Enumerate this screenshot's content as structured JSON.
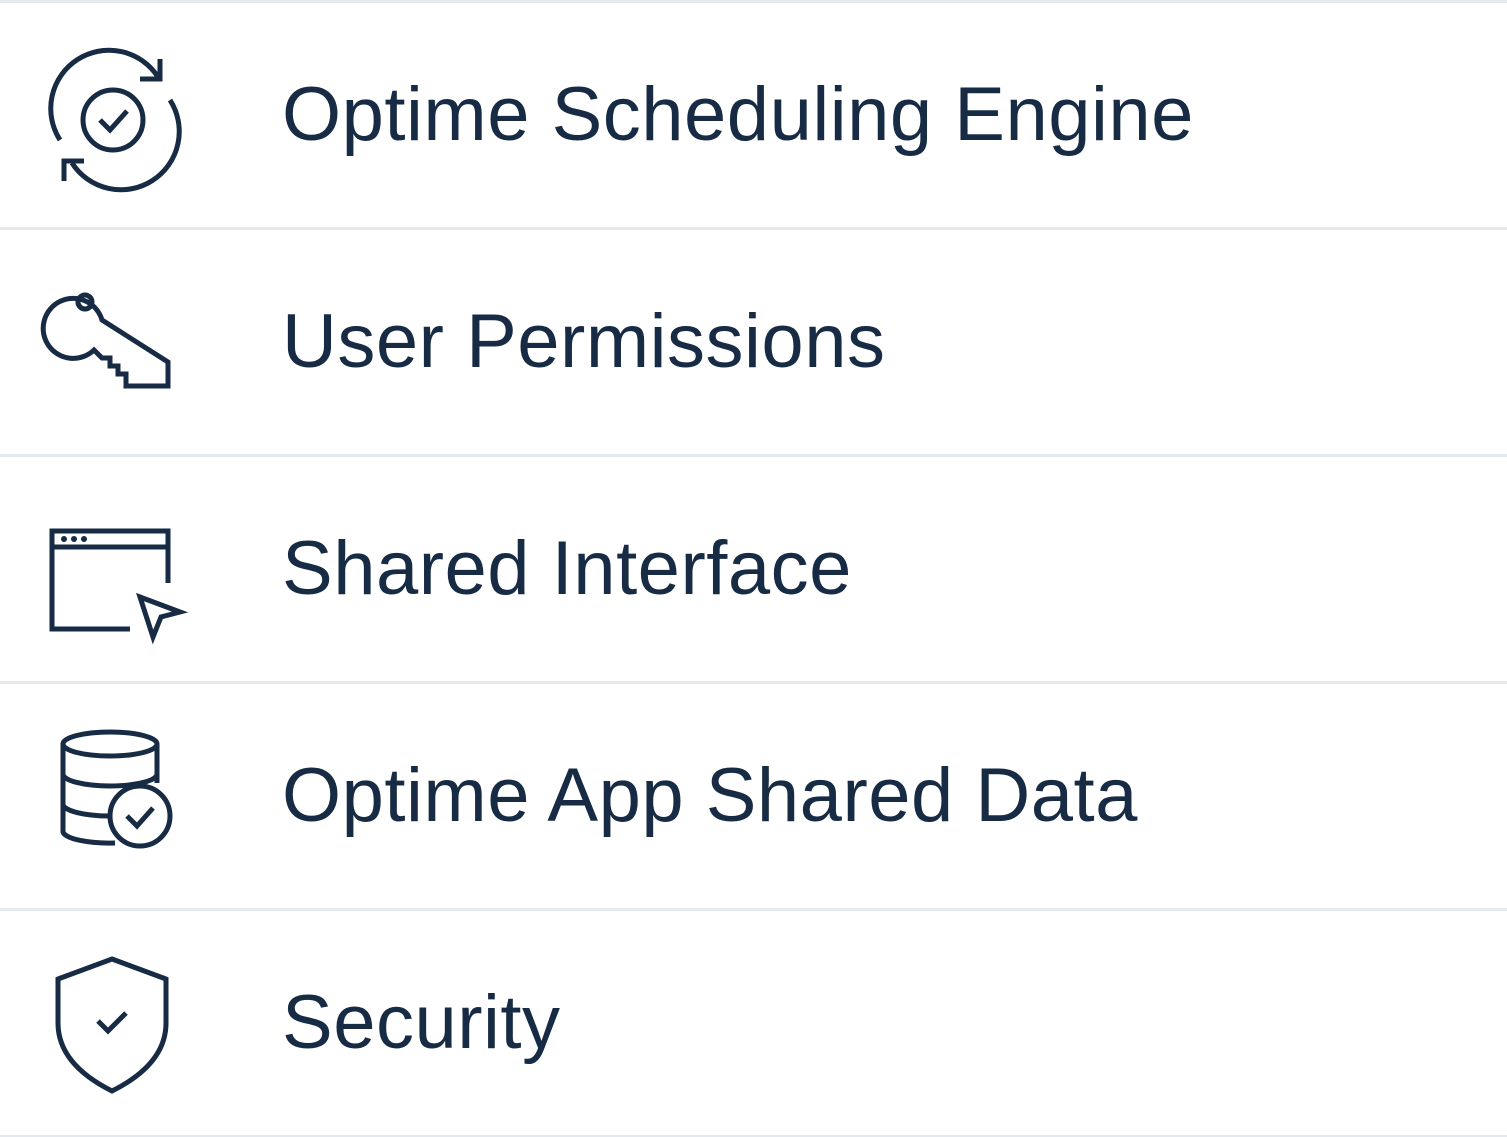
{
  "theme": {
    "text_color": "#172b44",
    "icon_color": "#172b44",
    "divider_color": "#e3e9ee",
    "background": "#ffffff"
  },
  "features": {
    "items": [
      {
        "label": "Optime Scheduling Engine",
        "icon": "sync-check-icon"
      },
      {
        "label": "User Permissions",
        "icon": "key-icon"
      },
      {
        "label": "Shared Interface",
        "icon": "browser-cursor-icon"
      },
      {
        "label": "Optime App Shared Data",
        "icon": "database-check-icon"
      },
      {
        "label": "Security",
        "icon": "shield-check-icon"
      }
    ]
  }
}
